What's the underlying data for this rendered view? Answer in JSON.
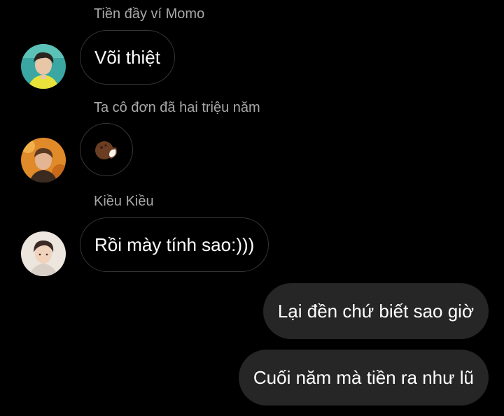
{
  "messages": [
    {
      "sender": "Tiền đầy ví Momo",
      "text": "Või thiệt",
      "avatar": "avatar-teal-bg-yellow-shirt"
    },
    {
      "sender": "Ta cô đơn đã hai triệu năm",
      "emoji": "coconut-icon",
      "avatar": "avatar-orange-bg"
    },
    {
      "sender": "Kiều Kiều",
      "text": "Rồi mày tính sao:)))",
      "avatar": "avatar-light-bg"
    }
  ],
  "outgoing": [
    {
      "text": "Lại đền chứ biết sao giờ"
    },
    {
      "text": "Cuối năm mà tiền ra như lũ"
    }
  ],
  "colors": {
    "background": "#000000",
    "sender_name": "#a8a8a8",
    "incoming_border": "#363636",
    "outgoing_bubble": "#262626",
    "text": "#ffffff"
  }
}
